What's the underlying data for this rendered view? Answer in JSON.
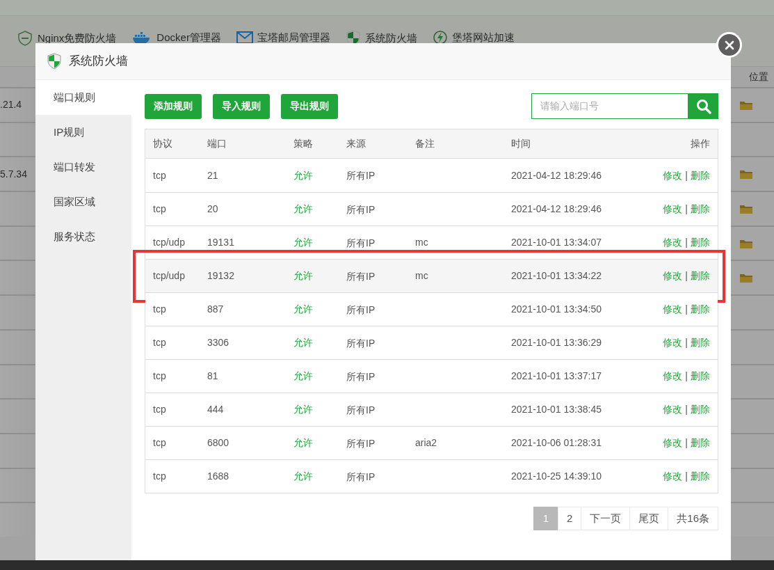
{
  "background": {
    "toolbar": [
      {
        "kind": "waf",
        "label": "Nginx免费防火墙"
      },
      {
        "kind": "docker",
        "label": "Docker管理器"
      },
      {
        "kind": "mail",
        "label": "宝塔邮局管理器"
      },
      {
        "kind": "shield",
        "label": "系统防火墙"
      },
      {
        "kind": "bolt",
        "label": "堡塔网站加速"
      }
    ],
    "header": "位置",
    "rows": [
      {
        "version": ".21.4",
        "folder": true
      },
      {
        "folder": false
      },
      {
        "version": "5.7.34",
        "folder": true
      },
      {
        "folder": true
      },
      {
        "folder": true
      },
      {
        "folder": true
      },
      {
        "folder": false
      },
      {
        "folder": false
      },
      {
        "folder": false
      },
      {
        "folder": false
      },
      {
        "folder": false
      },
      {
        "folder": false
      },
      {
        "folder": false
      }
    ]
  },
  "dialog": {
    "title": "系统防火墙",
    "sidebar": {
      "items": [
        {
          "label": "端口规则",
          "selected": true
        },
        {
          "label": "IP规则",
          "selected": false
        },
        {
          "label": "端口转发",
          "selected": false
        },
        {
          "label": "国家区域",
          "selected": false
        },
        {
          "label": "服务状态",
          "selected": false
        }
      ]
    },
    "buttons": [
      "添加规则",
      "导入规则",
      "导出规则"
    ],
    "search": {
      "placeholder": "请输入端口号"
    },
    "table": {
      "columns": [
        "协议",
        "端口",
        "策略",
        "来源",
        "备注",
        "时间",
        "操作"
      ],
      "rows": [
        {
          "protocol": "tcp",
          "port": "21",
          "policy": "允许",
          "source": "所有IP",
          "time": "2021-04-12 18:29:46",
          "edit": "修改",
          "sep": "|",
          "delete": "删除",
          "highlighted": false
        },
        {
          "protocol": "tcp",
          "port": "20",
          "policy": "允许",
          "source": "所有IP",
          "time": "2021-04-12 18:29:46",
          "edit": "修改",
          "sep": "|",
          "delete": "删除",
          "highlighted": false
        },
        {
          "protocol": "tcp/udp",
          "port": "19131",
          "policy": "允许",
          "source": "所有IP",
          "note": "mc",
          "time": "2021-10-01 13:34:07",
          "edit": "修改",
          "sep": "|",
          "delete": "删除",
          "highlighted": false
        },
        {
          "protocol": "tcp/udp",
          "port": "19132",
          "policy": "允许",
          "source": "所有IP",
          "note": "mc",
          "time": "2021-10-01 13:34:22",
          "edit": "修改",
          "sep": "|",
          "delete": "删除",
          "highlighted": true
        },
        {
          "protocol": "tcp",
          "port": "887",
          "policy": "允许",
          "source": "所有IP",
          "time": "2021-10-01 13:34:50",
          "edit": "修改",
          "sep": "|",
          "delete": "删除",
          "highlighted": false
        },
        {
          "protocol": "tcp",
          "port": "3306",
          "policy": "允许",
          "source": "所有IP",
          "time": "2021-10-01 13:36:29",
          "edit": "修改",
          "sep": "|",
          "delete": "删除",
          "highlighted": false
        },
        {
          "protocol": "tcp",
          "port": "81",
          "policy": "允许",
          "source": "所有IP",
          "time": "2021-10-01 13:37:17",
          "edit": "修改",
          "sep": "|",
          "delete": "删除",
          "highlighted": false
        },
        {
          "protocol": "tcp",
          "port": "444",
          "policy": "允许",
          "source": "所有IP",
          "time": "2021-10-01 13:38:45",
          "edit": "修改",
          "sep": "|",
          "delete": "删除",
          "highlighted": false
        },
        {
          "protocol": "tcp",
          "port": "6800",
          "policy": "允许",
          "source": "所有IP",
          "note": "aria2",
          "time": "2021-10-06 01:28:31",
          "edit": "修改",
          "sep": "|",
          "delete": "删除",
          "highlighted": false
        },
        {
          "protocol": "tcp",
          "port": "1688",
          "policy": "允许",
          "source": "所有IP",
          "time": "2021-10-25 14:39:10",
          "edit": "修改",
          "sep": "|",
          "delete": "删除",
          "highlighted": false
        }
      ]
    },
    "pagination": {
      "pages": [
        {
          "label": "1",
          "selected": true
        },
        {
          "label": "2",
          "selected": false
        },
        {
          "label": "下一页",
          "selected": false
        },
        {
          "label": "尾页",
          "selected": false
        }
      ],
      "total": "共16条"
    }
  }
}
